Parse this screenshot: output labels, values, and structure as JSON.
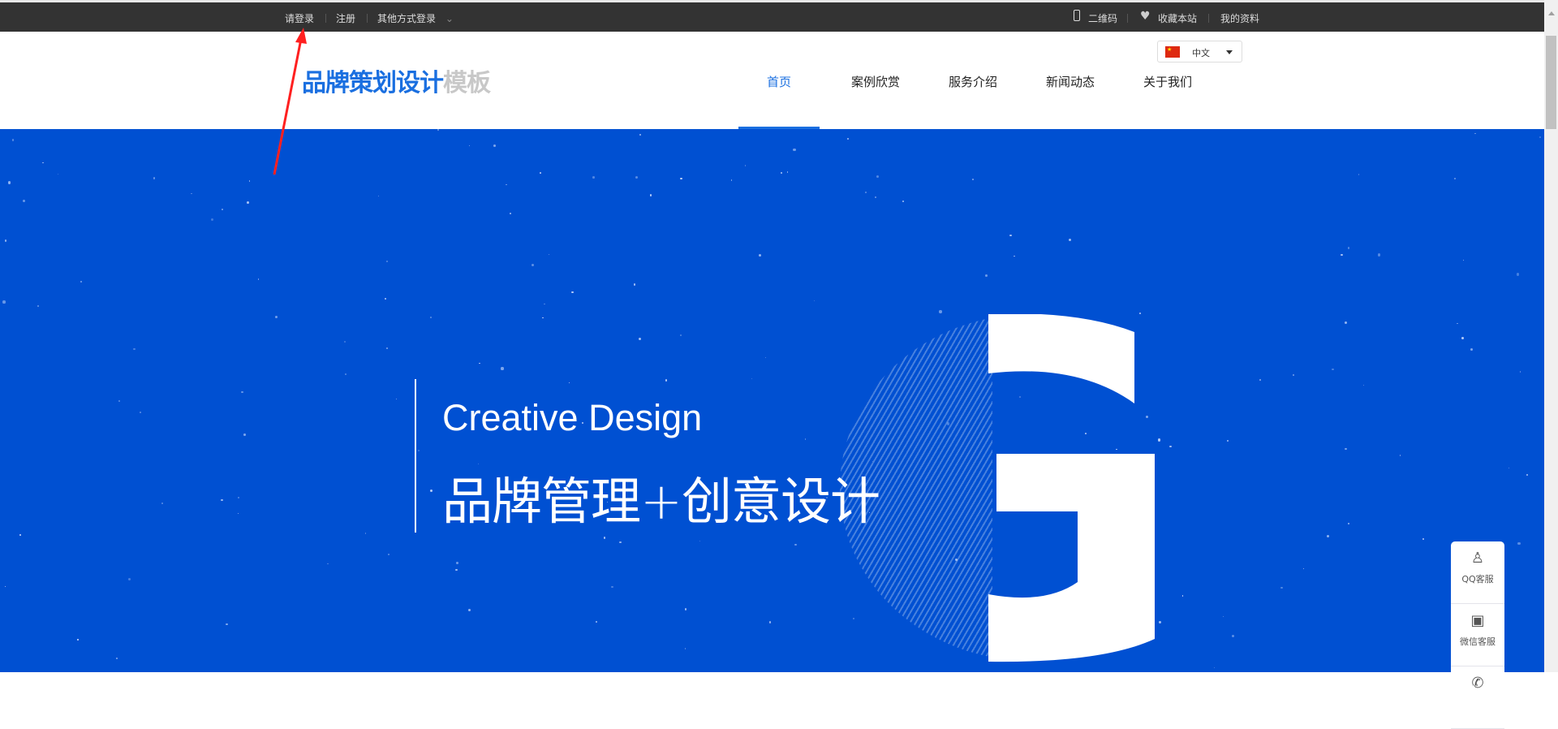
{
  "topbar": {
    "login": "请登录",
    "register": "注册",
    "other_login": "其他方式登录",
    "qrcode": "二维码",
    "favorite": "收藏本站",
    "profile": "我的资料"
  },
  "header": {
    "logo_main": "品牌策划设计",
    "logo_suffix": "模板",
    "nav": [
      {
        "label": "首页",
        "active": true
      },
      {
        "label": "案例欣赏"
      },
      {
        "label": "服务介绍"
      },
      {
        "label": "新闻动态"
      },
      {
        "label": "关于我们"
      }
    ],
    "language": "中文"
  },
  "hero": {
    "title_en": "Creative Design",
    "title_cn": "品牌管理+创意设计"
  },
  "side_widget": {
    "items": [
      {
        "label": "QQ客服",
        "icon": "qq-icon"
      },
      {
        "label": "微信客服",
        "icon": "qrcode-icon"
      },
      {
        "label": "",
        "icon": "phone-icon"
      }
    ]
  },
  "colors": {
    "brand": "#1a6fe0",
    "hero_bg": "#0050d2",
    "topbar": "#333333",
    "annotation": "#ff2020"
  }
}
